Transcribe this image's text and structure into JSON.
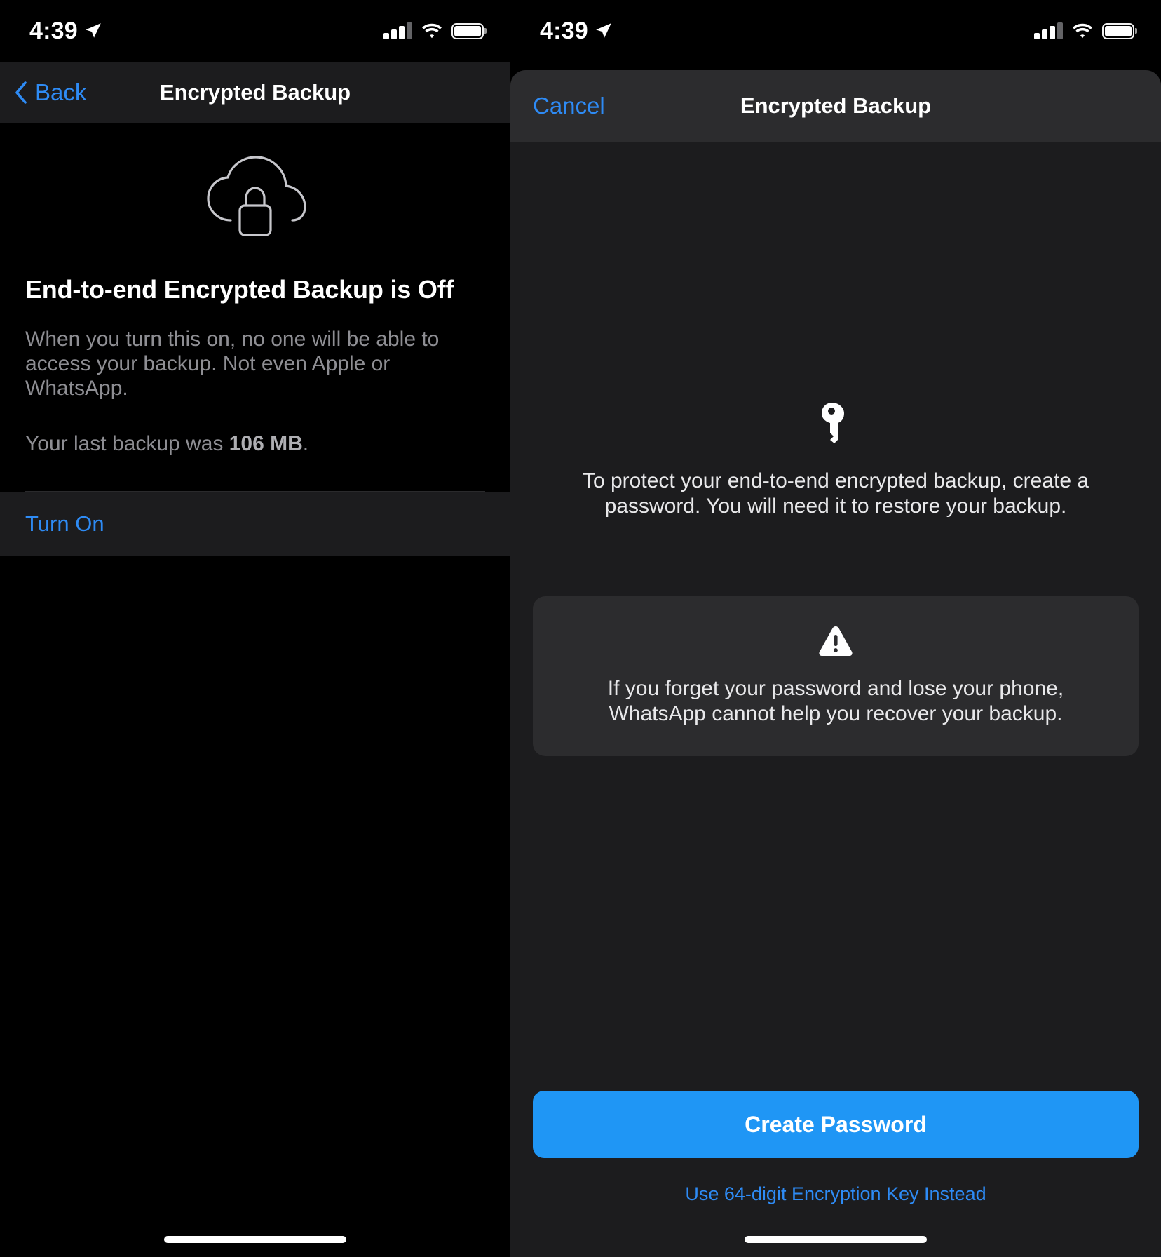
{
  "left": {
    "status": {
      "time": "4:39",
      "location_icon": "location-arrow-icon",
      "cellular_icon": "cellular-signal-icon",
      "wifi_icon": "wifi-icon",
      "battery_icon": "battery-icon"
    },
    "nav": {
      "back_label": "Back",
      "back_icon": "chevron-left-icon",
      "title": "Encrypted Backup"
    },
    "hero_icon": "cloud-lock-icon",
    "headline": "End-to-end Encrypted Backup is Off",
    "description": "When you turn this on, no one will be able to access your backup. Not even Apple or WhatsApp.",
    "backup_prefix": "Your last backup was ",
    "backup_size": "106 MB",
    "backup_suffix": ".",
    "turn_on_label": "Turn On"
  },
  "right": {
    "status": {
      "time": "4:39",
      "location_icon": "location-arrow-icon",
      "cellular_icon": "cellular-signal-icon",
      "wifi_icon": "wifi-icon",
      "battery_icon": "battery-icon"
    },
    "nav": {
      "cancel_label": "Cancel",
      "title": "Encrypted Backup"
    },
    "hero_icon": "key-icon",
    "intro": "To protect your end-to-end encrypted backup, create a password. You will need it to restore your backup.",
    "warning_icon": "warning-triangle-icon",
    "warning": "If you forget your password and lose your phone, WhatsApp cannot help you recover your backup.",
    "primary_button": "Create Password",
    "alt_link": "Use 64-digit Encryption Key Instead"
  },
  "colors": {
    "accent_blue": "#2e8bf5",
    "button_blue": "#1f96f5",
    "sheet_bg": "#1c1c1e",
    "card_bg": "#2c2c2e",
    "screen_bg": "#000000",
    "secondary_text": "#8e8e93"
  }
}
